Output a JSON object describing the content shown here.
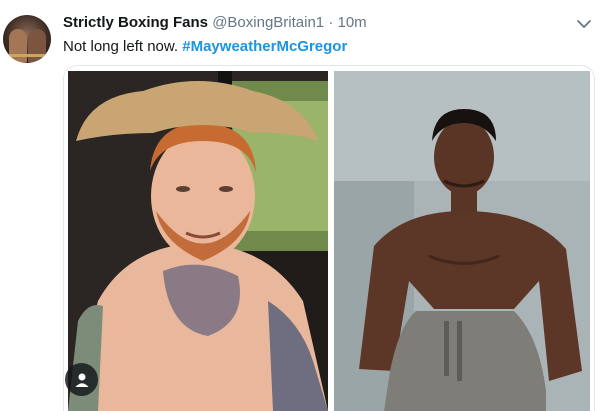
{
  "tweet": {
    "author_name": "Strictly Boxing Fans",
    "handle": "@BoxingBritain1",
    "separator": "·",
    "time": "10m",
    "text": "Not long left now. ",
    "hashtag": "#MayweatherMcGregor"
  },
  "media": {
    "photos": [
      {
        "subject": "shirtless man with red hair, cowboy hat and chest tattoos"
      },
      {
        "subject": "shirtless man sitting in grey sweatpants"
      }
    ],
    "overlay_icon": "user-silhouette-icon"
  },
  "icons": {
    "menu": "chevron-down-icon",
    "avatar": "avatar"
  },
  "colors": {
    "link": "#1b95e0",
    "text": "#14171a",
    "muted": "#657786",
    "border": "#e1e8ed"
  }
}
